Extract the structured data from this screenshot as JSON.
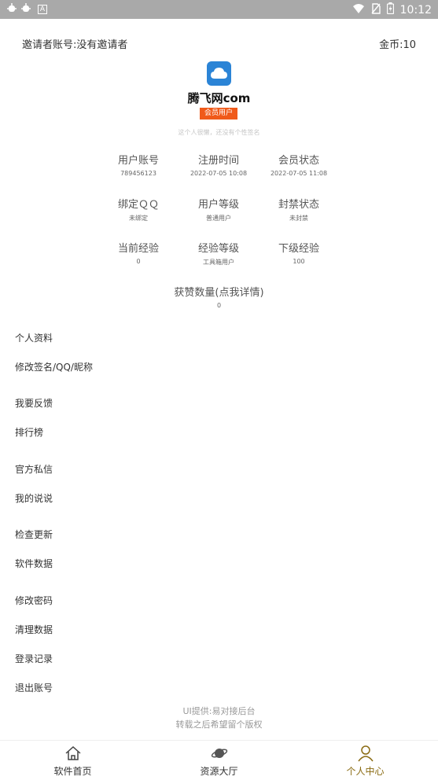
{
  "status_bar": {
    "time": "10:12",
    "left_icons": [
      "bug-icon",
      "bug-icon",
      "a-icon"
    ],
    "right_icons": [
      "wifi-icon",
      "no-sim-icon",
      "battery-icon"
    ]
  },
  "header": {
    "inviter": "邀请者账号:没有邀请者",
    "coins": "金币:10"
  },
  "profile": {
    "site_name": "腾飞网com",
    "badge": "会员用户",
    "signature": "这个人很懒，还没有个性签名",
    "logo_color": "#2b84d6",
    "badge_color": "#f05a1a"
  },
  "stats": [
    {
      "label": "用户账号",
      "value": "789456123"
    },
    {
      "label": "注册时间",
      "value": "2022-07-05 10:08"
    },
    {
      "label": "会员状态",
      "value": "2022-07-05 11:08"
    },
    {
      "label": "绑定ＱＱ",
      "value": "未绑定"
    },
    {
      "label": "用户等级",
      "value": "普通用户"
    },
    {
      "label": "封禁状态",
      "value": "未封禁"
    },
    {
      "label": "当前经验",
      "value": "0"
    },
    {
      "label": "经验等级",
      "value": "工具箱用户"
    },
    {
      "label": "下级经验",
      "value": "100"
    }
  ],
  "likes": {
    "label": "获赞数量(点我详情)",
    "value": "0"
  },
  "menu": [
    "个人资料",
    "修改签名/QQ/昵称",
    "我要反馈",
    "排行榜",
    "官方私信",
    "我的说说",
    "检查更新",
    "软件数据",
    "修改密码",
    "清理数据",
    "登录记录",
    "退出账号"
  ],
  "credits": {
    "line1": "UI提供:易对接后台",
    "line2": "转载之后希望留个版权"
  },
  "tabs": [
    {
      "label": "软件首页",
      "icon": "home-icon",
      "active": false
    },
    {
      "label": "资源大厅",
      "icon": "planet-icon",
      "active": false
    },
    {
      "label": "个人中心",
      "icon": "user-icon",
      "active": true
    }
  ],
  "colors": {
    "active_tab": "#8a6b12"
  }
}
